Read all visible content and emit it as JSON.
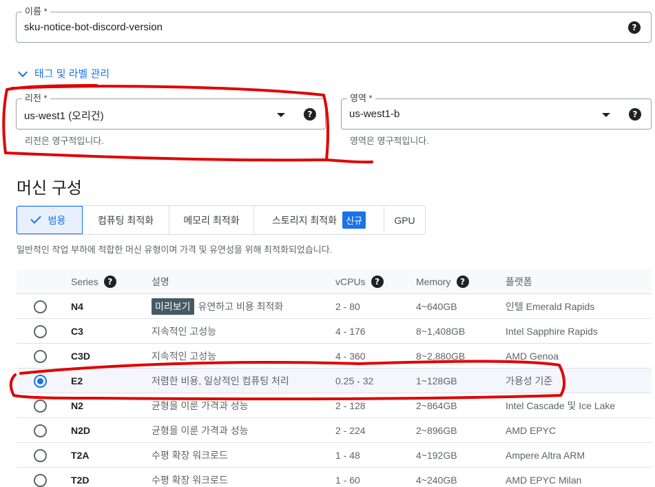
{
  "name_field": {
    "label": "이름 *",
    "value": "sku-notice-bot-discord-version"
  },
  "tags_toggle": {
    "label": "태그 및 라벨 관리"
  },
  "region": {
    "label": "리전 *",
    "value": "us-west1 (오리건)",
    "hint": "리전은 영구적입니다."
  },
  "zone": {
    "label": "영역 *",
    "value": "us-west1-b",
    "hint": "영역은 영구적입니다."
  },
  "machine_config": {
    "title": "머신 구성",
    "tabs": [
      {
        "label": "범용",
        "active": true
      },
      {
        "label": "컴퓨팅 최적화"
      },
      {
        "label": "메모리 최적화"
      },
      {
        "label": "스토리지 최적화",
        "badge": "신규"
      },
      {
        "label": "GPU"
      }
    ],
    "description": "일반적인 작업 부하에 적합한 머신 유형이며 가격 및 유연성을 위해 최적화되었습니다."
  },
  "table": {
    "headers": {
      "series": "Series",
      "desc": "설명",
      "vcpus": "vCPUs",
      "memory": "Memory",
      "platform": "플랫폼"
    },
    "rows": [
      {
        "series": "N4",
        "tag": "미리보기",
        "desc": "유연하고 비용 최적화",
        "vcpus": "2 - 80",
        "memory": "4~640GB",
        "platform": "인텔 Emerald Rapids",
        "selected": false
      },
      {
        "series": "C3",
        "tag": "",
        "desc": "지속적인 고성능",
        "vcpus": "4 - 176",
        "memory": "8~1,408GB",
        "platform": "Intel Sapphire Rapids",
        "selected": false
      },
      {
        "series": "C3D",
        "tag": "",
        "desc": "지속적인 고성능",
        "vcpus": "4 - 360",
        "memory": "8~2,880GB",
        "platform": "AMD Genoa",
        "selected": false
      },
      {
        "series": "E2",
        "tag": "",
        "desc": "저렴한 비용, 일상적인 컴퓨팅 처리",
        "vcpus": "0.25 - 32",
        "memory": "1~128GB",
        "platform": "가용성 기준",
        "selected": true
      },
      {
        "series": "N2",
        "tag": "",
        "desc": "균형을 이룬 가격과 성능",
        "vcpus": "2 - 128",
        "memory": "2~864GB",
        "platform": "Intel Cascade 및 Ice Lake",
        "selected": false
      },
      {
        "series": "N2D",
        "tag": "",
        "desc": "균형을 이룬 가격과 성능",
        "vcpus": "2 - 224",
        "memory": "2~896GB",
        "platform": "AMD EPYC",
        "selected": false
      },
      {
        "series": "T2A",
        "tag": "",
        "desc": "수평 확장 워크로드",
        "vcpus": "1 - 48",
        "memory": "4~192GB",
        "platform": "Ampere Altra ARM",
        "selected": false
      },
      {
        "series": "T2D",
        "tag": "",
        "desc": "수평 확장 워크로드",
        "vcpus": "1 - 60",
        "memory": "4~240GB",
        "platform": "AMD EPYC Milan",
        "selected": false
      }
    ]
  },
  "icons": {
    "help": "?",
    "help_icon": "help-circle-icon",
    "caret": "caret-down-icon",
    "chevron": "chevron-down-icon",
    "check": "check-icon"
  },
  "colors": {
    "accent": "#1a73e8",
    "annotation": "#e00000",
    "preview_tag": "#455a64"
  }
}
